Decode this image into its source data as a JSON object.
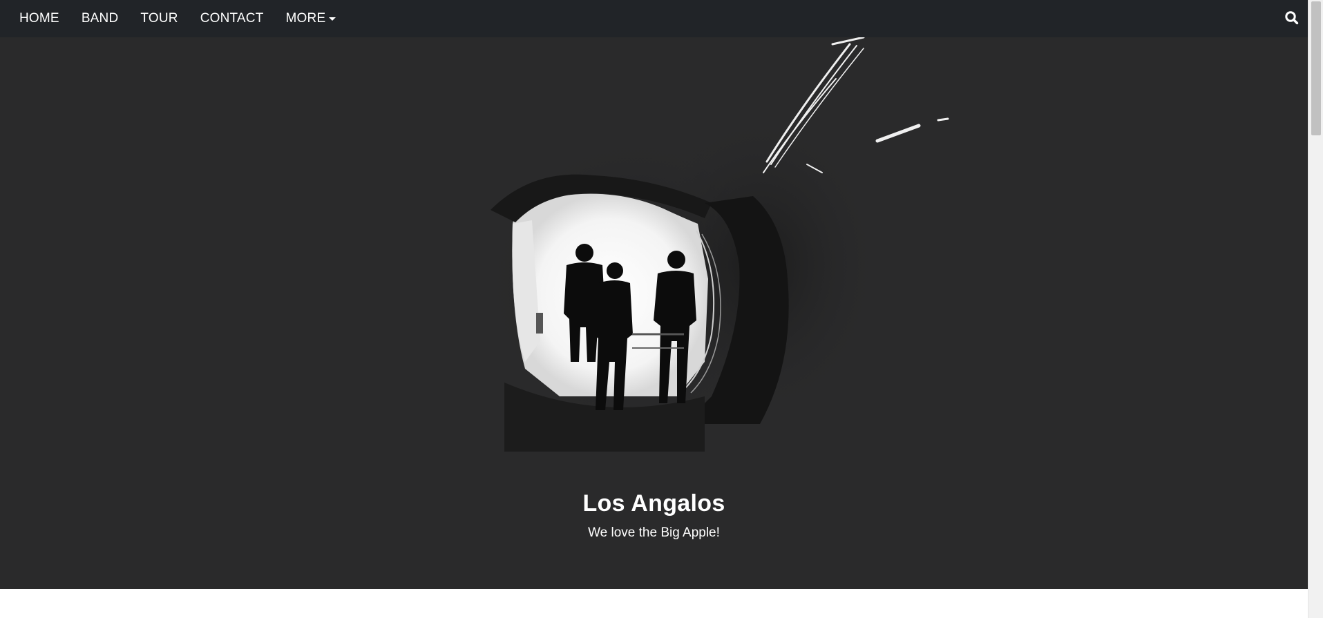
{
  "nav": {
    "items": [
      {
        "label": "HOME"
      },
      {
        "label": "BAND"
      },
      {
        "label": "TOUR"
      },
      {
        "label": "CONTACT"
      },
      {
        "label": "MORE"
      }
    ],
    "search_icon": "search-icon",
    "dropdown_icon": "caret-down-icon"
  },
  "hero": {
    "caption_title": "Los Angalos",
    "caption_text": "We love the Big Apple!"
  },
  "colors": {
    "navbar_bg": "#212428",
    "hero_bg": "#2a2a2b",
    "text": "#ffffff"
  }
}
